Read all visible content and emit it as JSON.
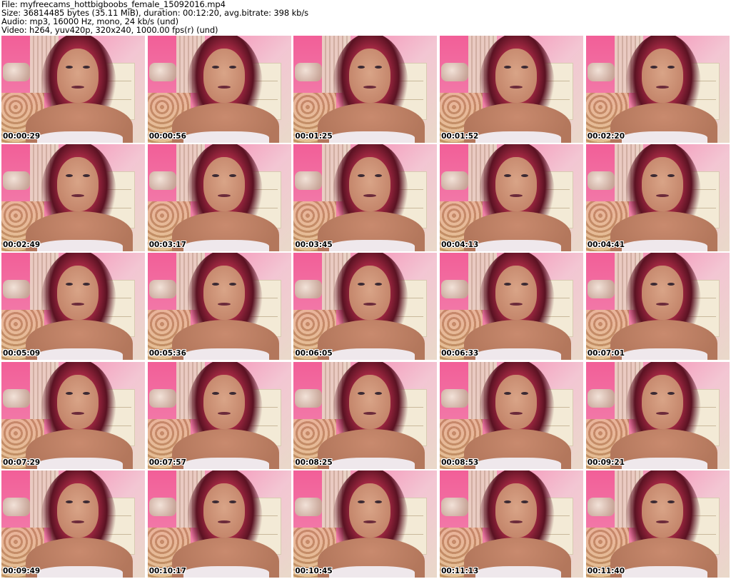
{
  "header": {
    "file": "File: myfreecams_hottbigboobs_female_15092016.mp4",
    "size": "Size: 36814485 bytes (35.11 MiB), duration: 00:12:20, avg.bitrate: 398 kb/s",
    "audio": "Audio: mp3, 16000 Hz, mono, 24 kb/s (und)",
    "video": "Video: h264, yuv420p, 320x240, 1000.00 fps(r) (und)"
  },
  "thumbnails": [
    {
      "timestamp": "00:00:29"
    },
    {
      "timestamp": "00:00:56"
    },
    {
      "timestamp": "00:01:25"
    },
    {
      "timestamp": "00:01:52"
    },
    {
      "timestamp": "00:02:20"
    },
    {
      "timestamp": "00:02:49"
    },
    {
      "timestamp": "00:03:17"
    },
    {
      "timestamp": "00:03:45"
    },
    {
      "timestamp": "00:04:13"
    },
    {
      "timestamp": "00:04:41"
    },
    {
      "timestamp": "00:05:09"
    },
    {
      "timestamp": "00:05:36"
    },
    {
      "timestamp": "00:06:05"
    },
    {
      "timestamp": "00:06:33"
    },
    {
      "timestamp": "00:07:01"
    },
    {
      "timestamp": "00:07:29"
    },
    {
      "timestamp": "00:07:57"
    },
    {
      "timestamp": "00:08:25"
    },
    {
      "timestamp": "00:08:53"
    },
    {
      "timestamp": "00:09:21"
    },
    {
      "timestamp": "00:09:49"
    },
    {
      "timestamp": "00:10:17"
    },
    {
      "timestamp": "00:10:45"
    },
    {
      "timestamp": "00:11:13"
    },
    {
      "timestamp": "00:11:40"
    }
  ]
}
